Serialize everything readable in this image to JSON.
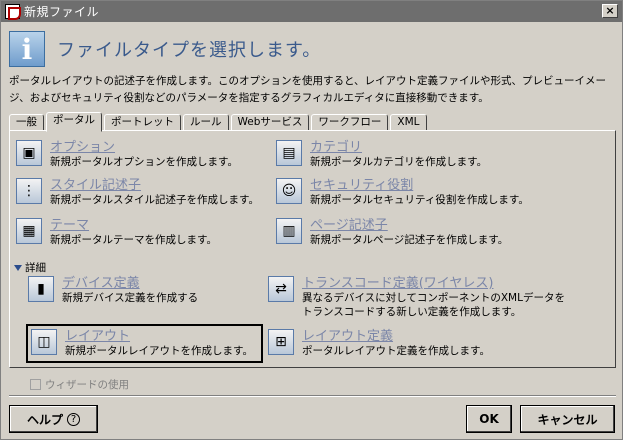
{
  "window": {
    "title": "新規ファイル",
    "close": "×"
  },
  "header": {
    "icon": "i",
    "title": "ファイルタイプを選択します。"
  },
  "description": "ポータルレイアウトの記述子を作成します。このオプションを使用すると、レイアウト定義ファイルや形式、プレビューイメージ、およびセキュリティ役割などのパラメータを指定するグラフィカルエディタに直接移動できます。",
  "tabs": [
    "一般",
    "ポータル",
    "ポートレット",
    "ルール",
    "Webサービス",
    "ワークフロー",
    "XML"
  ],
  "active_tab": "ポータル",
  "items": [
    {
      "name": "オプション",
      "sub": "新規ポータルオプションを作成します。",
      "icon": "options-icon"
    },
    {
      "name": "カテゴリ",
      "sub": "新規ポータルカテゴリを作成します。",
      "icon": "category-icon"
    },
    {
      "name": "スタイル記述子",
      "sub": "新規ポータルスタイル記述子を作成します。",
      "icon": "style-descriptor-icon"
    },
    {
      "name": "セキュリティ役割",
      "sub": "新規ポータルセキュリティ役割を作成します。",
      "icon": "security-role-icon"
    },
    {
      "name": "テーマ",
      "sub": "新規ポータルテーマを作成します。",
      "icon": "theme-icon"
    },
    {
      "name": "ページ記述子",
      "sub": "新規ポータルページ記述子を作成します。",
      "icon": "page-descriptor-icon"
    }
  ],
  "details": {
    "label": "詳細",
    "items": [
      {
        "name": "デバイス定義",
        "sub": "新規デバイス定義を作成する",
        "icon": "device-definition-icon"
      },
      {
        "name": "トランスコード定義(ワイヤレス)",
        "sub1": "異なるデバイスに対してコンポーネントのXMLデータを",
        "sub2": "トランスコードする新しい定義を作成します。",
        "icon": "transcode-icon"
      },
      {
        "name": "レイアウト",
        "sub": "新規ポータルレイアウトを作成します。",
        "icon": "layout-icon",
        "selected": true
      },
      {
        "name": "レイアウト定義",
        "sub": "ポータルレイアウト定義を作成します。",
        "icon": "layout-definition-icon"
      }
    ]
  },
  "wizard": "ウィザードの使用",
  "buttons": {
    "help": "ヘルプ",
    "help_icon": "?",
    "ok": "OK",
    "cancel": "キャンセル"
  }
}
